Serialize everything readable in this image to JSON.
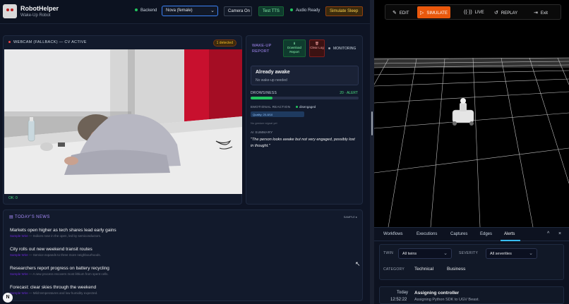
{
  "app": {
    "title": "RobotHelper",
    "subtitle": "Wake-Up Robot"
  },
  "toolbar": {
    "backend_label": "Backend",
    "voice_select_value": "Nova (female)",
    "camera_button": "Camera On",
    "tts_button": "Test TTS",
    "audio_status": "Audio Ready",
    "sleep_button": "Simulate Sleep",
    "status_color": "#22c55e"
  },
  "webcam": {
    "header": "WEBCAM (FALLBACK) — CV ACTIVE",
    "detected_badge": "1 detected",
    "status": "OK: 0"
  },
  "report": {
    "title": "WAKE-UP REPORT",
    "download_button": "Download Report",
    "clear_button": "Clear Log",
    "monitoring": "MONITORING",
    "state_title": "Already awake",
    "state_sub": "No wake-up needed",
    "drowsiness_label": "DROWSINESS",
    "drowsiness_value": "20 · ALERT",
    "drowsiness_level": 0.2,
    "emotion_label": "EMOTIONAL REACTION",
    "emotion_tag": "disengaged",
    "quality": "Quality: 20-8/10",
    "no_gesture": "No gesture signal yet",
    "ai_label": "AI SUMMARY",
    "ai_quote": "\"The person looks awake but not very engaged, possibly lost in thought.\""
  },
  "news": {
    "title": "TODAY'S NEWS",
    "sample_label": "SAMPLE",
    "items": [
      {
        "headline": "Markets open higher as tech shares lead early gains",
        "source": "Sample Wire",
        "summary": "Indices rose in the open, led by semiconductors."
      },
      {
        "headline": "City rolls out new weekend transit routes",
        "source": "Sample Wire",
        "summary": "Service expands to three more neighbourhoods."
      },
      {
        "headline": "Researchers report progress on battery recycling",
        "source": "Sample Wire",
        "summary": "A new process recovers most lithium from spent cells."
      },
      {
        "headline": "Forecast: clear skies through the weekend",
        "source": "Sample Wire",
        "summary": "Mild temperatures and low humidity expected."
      }
    ]
  },
  "modes": [
    {
      "icon": "✎",
      "label": "EDIT",
      "icon_name": "edit-icon"
    },
    {
      "icon": "▷",
      "label": "SIMULATE",
      "icon_name": "play-icon"
    },
    {
      "icon": "((·))",
      "label": "LIVE",
      "icon_name": "broadcast-icon"
    },
    {
      "icon": "↺",
      "label": "REPLAY",
      "icon_name": "replay-icon"
    },
    {
      "icon": "⇥",
      "label": "Exit",
      "icon_name": "exit-icon"
    }
  ],
  "active_mode": "SIMULATE",
  "accent_color": "#ea580c",
  "bottom_panel": {
    "tabs": [
      "Workflows",
      "Executions",
      "Captures",
      "Edges",
      "Alerts"
    ],
    "active_tab": "Alerts",
    "collapse_icon": "^",
    "close_icon": "×",
    "twin_label": "TWIN",
    "twin_value": "All twins",
    "severity_label": "SEVERITY",
    "severity_value": "All severities",
    "category_label": "CATEGORY",
    "categories": [
      "Technical",
      "Business"
    ],
    "alert": {
      "day": "Today",
      "time": "12:52:22",
      "title": "Assigning controller",
      "description": "Assigning Python SDK to UGV Beast."
    }
  },
  "badge_letter": "N"
}
